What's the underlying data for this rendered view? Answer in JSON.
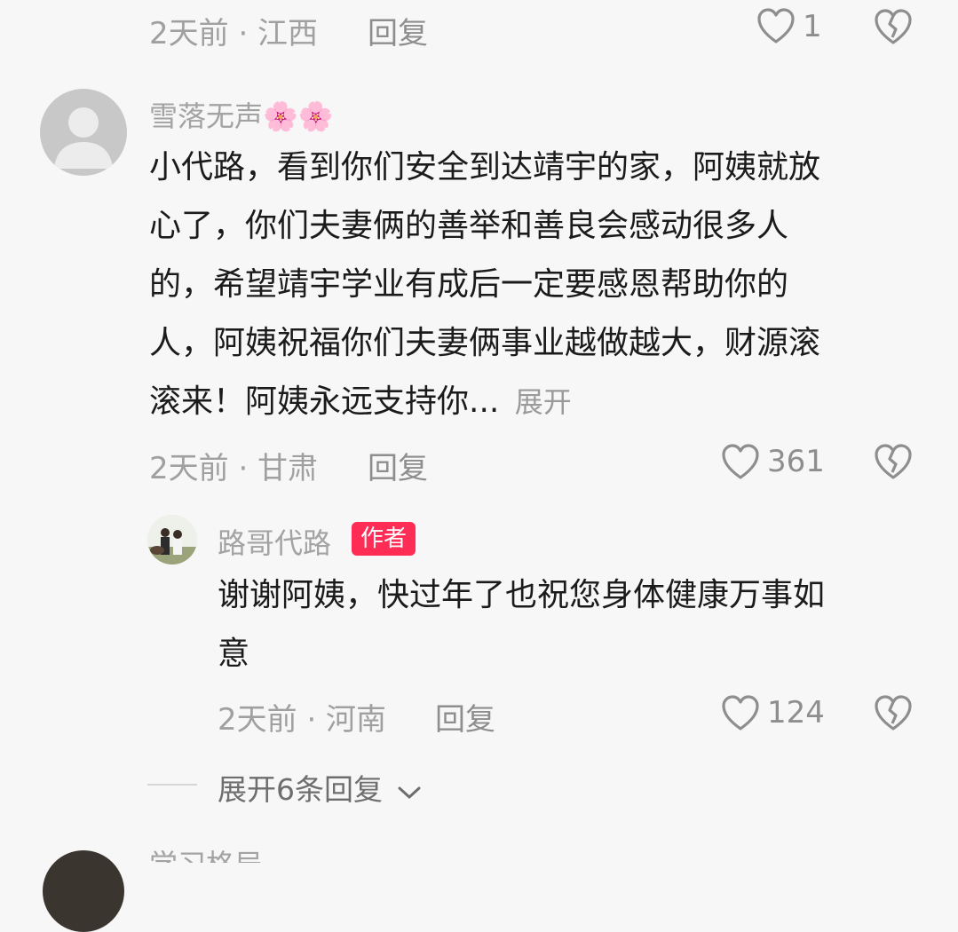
{
  "comment_prev": {
    "meta": "2天前 · 江西",
    "reply_label": "回复",
    "like_count": "1"
  },
  "comment_main": {
    "username": "雪落无声🌸🌸",
    "text_lines": [
      "小代路，看到你们安全到达靖宇的家，阿姨就放",
      "心了，你们夫妻俩的善举和善良会感动很多人",
      "的，希望靖宇学业有成后一定要感恩帮助你的",
      "人，阿姨祝福你们夫妻俩事业越做越大，财源滚",
      "滚来！阿姨永远支持你..."
    ],
    "expand_label": "展开",
    "meta": "2天前 · 甘肃",
    "reply_label": "回复",
    "like_count": "361"
  },
  "reply_author": {
    "username": "路哥代路",
    "author_badge": "作者",
    "text_lines": [
      "谢谢阿姨，快过年了也祝您身体健康万事如",
      "意"
    ],
    "meta": "2天前 · 河南",
    "reply_label": "回复",
    "like_count": "124"
  },
  "expand_replies": {
    "label": "展开6条回复"
  },
  "next_comment": {
    "username_partial": "学习格局"
  },
  "colors": {
    "background": "#f7f7f7",
    "text_primary": "#1b1b1b",
    "text_meta": "#a0a0a0",
    "author_badge": "#ff2d55"
  }
}
